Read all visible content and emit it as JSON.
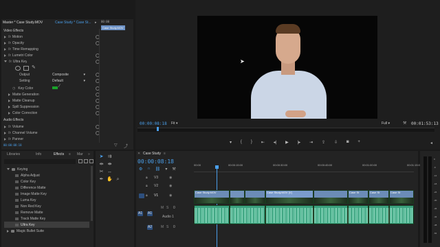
{
  "effect_controls": {
    "tab_master": "Master * Case Study.MOV",
    "tab_clip": "Case Study * Case St...",
    "mini_timecode": "00:00",
    "mini_clip": "Case Study.MOV",
    "section_video": "Video Effects",
    "items": {
      "motion": "Motion",
      "opacity": "Opacity",
      "time_remapping": "Time Remapping",
      "lumetri": "Lumetri Color",
      "ultra_key": "Ultra Key",
      "output_label": "Output",
      "output_value": "Composite",
      "setting_label": "Setting",
      "setting_value": "Default",
      "key_color": "Key Color",
      "matte_generation": "Matte Generation",
      "matte_cleanup": "Matte Cleanup",
      "spill_suppression": "Spill Suppression",
      "color_correction": "Color Correction"
    },
    "section_audio": "Audio Effects",
    "audio_items": {
      "volume": "Volume",
      "channel_volume": "Channel Volume",
      "panner": "Panner"
    },
    "bottom_timecode": "00:00:08:18",
    "fx_symbol": "fx"
  },
  "effects_panel": {
    "tabs": [
      "Libraries",
      "Info",
      "Effects",
      "Mar"
    ],
    "folder": "Keying",
    "items": [
      "Alpha Adjust",
      "Color Key",
      "Difference Matte",
      "Image Matte Key",
      "Luma Key",
      "Non Red Key",
      "Remove Matte",
      "Track Matte Key",
      "Ultra Key"
    ],
    "next_folder": "Magic Bullet Suite"
  },
  "program_monitor": {
    "timecode_current": "00:00:08:18",
    "fit": "Fit",
    "quality": "Full",
    "timecode_duration": "00:01:53:13",
    "accent": "#4a9fea"
  },
  "timeline": {
    "sequence_tab": "Case Study",
    "timecode": "00:00:08:18",
    "ruler": [
      "00:00",
      "00:00:15:00",
      "00:00:30:00",
      "00:00:45:00",
      "00:01:00:00",
      "00:01:15:00"
    ],
    "tracks": {
      "v3": "V3",
      "v2": "V2",
      "v1": "V1",
      "a1": "A1",
      "a2": "A2",
      "audio1": "Audio 1",
      "vol": "0"
    },
    "clips": [
      "Case Study.MOV",
      "Case Study.MOV [V]",
      "Case St",
      "Case St",
      "Case St"
    ],
    "meter_scale": [
      "0",
      "-6",
      "-12",
      "-18",
      "-24",
      "-30",
      "-36",
      "-42",
      "-48",
      "-54"
    ]
  }
}
